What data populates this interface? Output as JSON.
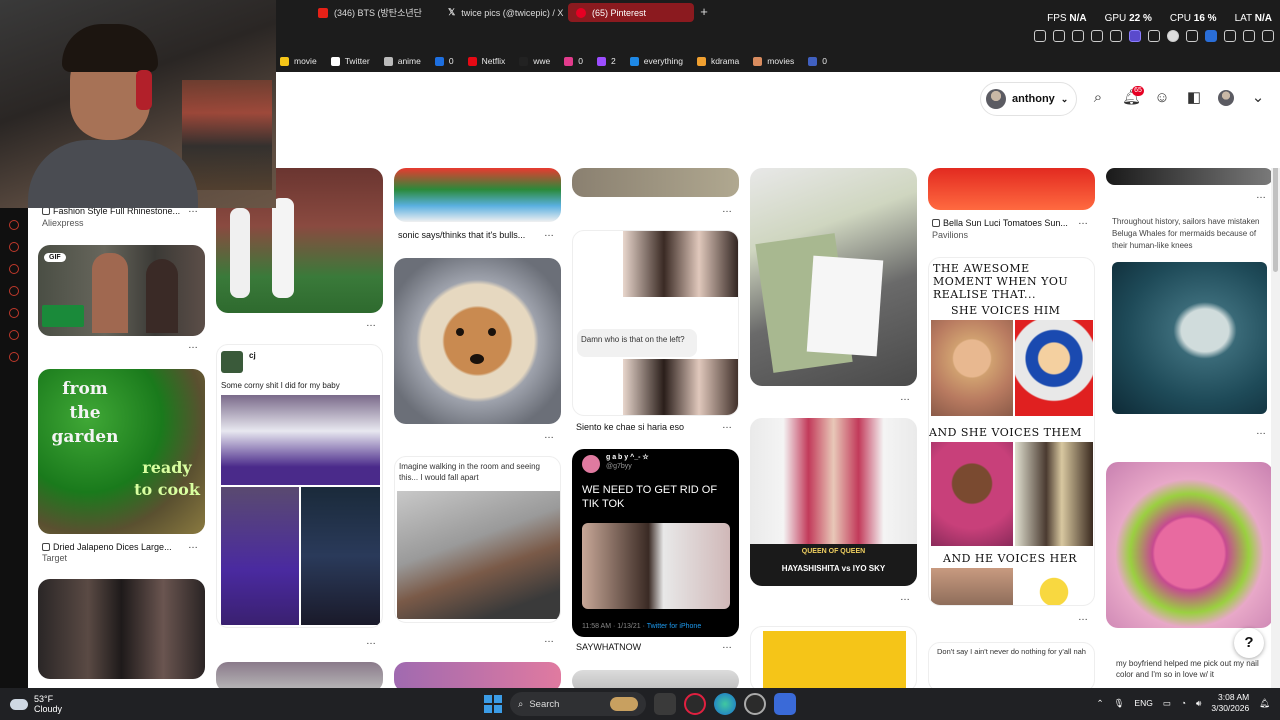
{
  "tabs": [
    {
      "label": "(346) BTS (방탄소년단",
      "color": "#e62117",
      "active": false
    },
    {
      "label": "twice pics (@twicepic) / X",
      "color": "#ffffff",
      "active": false
    },
    {
      "label": "(65) Pinterest",
      "color": "#e60023",
      "active": true
    }
  ],
  "new_tab_symbol": "+",
  "stats": {
    "fps_label": "FPS",
    "fps_value": "N/A",
    "gpu_label": "GPU",
    "gpu_value": "22 %",
    "cpu_label": "CPU",
    "cpu_value": "16 %",
    "lat_label": "LAT",
    "lat_value": "N/A"
  },
  "bookmarks": [
    {
      "label": "movie",
      "color": "#f5c518"
    },
    {
      "label": "Twitter",
      "color": "#ffffff"
    },
    {
      "label": "anime",
      "color": "#bbbbbb"
    },
    {
      "label": "0",
      "color": "#1d6fe0"
    },
    {
      "label": "Netflix",
      "color": "#e50914"
    },
    {
      "label": "wwe",
      "color": "#222222"
    },
    {
      "label": "0",
      "color": "#e23b8c"
    },
    {
      "label": "2",
      "color": "#9c4dff"
    },
    {
      "label": "everything",
      "color": "#1e88e5"
    },
    {
      "label": "kdrama",
      "color": "#f0a030"
    },
    {
      "label": "movies",
      "color": "#d98c5f"
    },
    {
      "label": "0",
      "color": "#4060c0"
    }
  ],
  "header": {
    "account_name": "anthony",
    "notif_count": "65",
    "brand_color": "#e60023"
  },
  "pins": {
    "c1_caption1": "Fashion Style Full Rhinestone...",
    "c1_sub1": "Aliexpress",
    "c1_gif": "GIF",
    "c1_green_text": "from the garden",
    "c1_green_text2": "ready to cook",
    "c1_caption2": "Dried Jalapeno Dices Large...",
    "c1_sub2": "Target",
    "c2_user": "cj",
    "c2_text": "Some corny shit I did for my baby",
    "c3_caption1": "sonic says/thinks that it's bulls...",
    "c3_text": "Imagine walking in the room and seeing this... I would fall apart",
    "c4_chat": "Damn who is that on the left?",
    "c4_caption": "Siento ke chae si haria eso",
    "c4_tweet_user": "g a b y ^_- ☆",
    "c4_tweet_handle": "@g7byy",
    "c4_tweet_text": "WE NEED TO GET RID OF TIK TOK",
    "c4_tweet_meta": "11:58 AM · 1/13/21",
    "c4_tweet_client": "Twitter for iPhone",
    "c4_caption2": "SAYWHATNOW",
    "c5_wrestle_title": "QUEEN OF QUEEN",
    "c5_wrestle_names": "HAYASHISHITA  vs  IYO SKY",
    "c6_caption": "Bella Sun Luci Tomatoes Sun...",
    "c6_sub": "Pavilions",
    "c6_meme1": "THE AWESOME MOMENT WHEN YOU REALISE THAT...",
    "c6_meme2": "SHE VOICES HIM",
    "c6_meme3": "AND SHE VOICES THEM",
    "c6_meme4": "AND HE VOICES HER",
    "c6_text2": "Don't say I ain't never do nothing for y'all nah",
    "c7_text": "Throughout history, sailors have mistaken Beluga Whales for mermaids because of their human-like knees",
    "c7_text2": "my boyfriend helped me pick out my nail color and I'm so in love w/ it"
  },
  "help_symbol": "?",
  "taskbar": {
    "temp": "53°F",
    "condition": "Cloudy",
    "search_label": "Search",
    "lang": "ENG",
    "time": "3:08 AM",
    "date": "3/30/2026"
  }
}
